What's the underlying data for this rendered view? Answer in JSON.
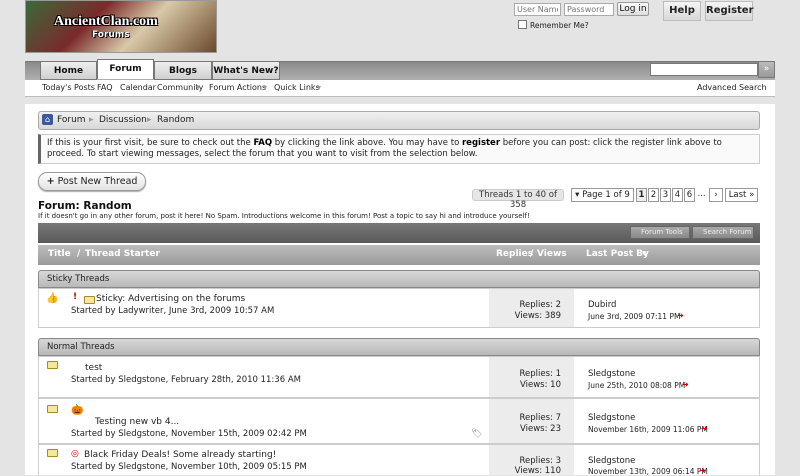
{
  "header": {
    "logo_text": "AncientClan.com",
    "logo_sub": "Forums",
    "username_placeholder": "User Name",
    "password_placeholder": "Password",
    "login_label": "Log in",
    "remember_label": "Remember Me?",
    "help_label": "Help",
    "register_label": "Register"
  },
  "nav": {
    "tabs": [
      "Home",
      "Forum",
      "Blogs",
      "What's New?"
    ],
    "sub": [
      "Today's Posts",
      "FAQ",
      "Calendar",
      "Community",
      "Forum Actions",
      "Quick Links"
    ],
    "advanced_search": "Advanced Search",
    "search_go": "»"
  },
  "breadcrumb": [
    "Forum",
    "Discussion",
    "Random"
  ],
  "notice": {
    "p1": "If this is your first visit, be sure to check out the",
    "faq": "FAQ",
    "p2": "by clicking the link above. You may have to",
    "register": "register",
    "p3": "before you can post: click the register link above to proceed. To start viewing messages, select the forum that you want to visit from the selection below."
  },
  "actions": {
    "new_thread": "Post New Thread",
    "threads_count": "Threads 1 to 40 of 358",
    "page_of": "Page 1 of 9",
    "pages": [
      "1",
      "2",
      "3",
      "4",
      "6"
    ],
    "ellipsis": "...",
    "next": "›",
    "last": "Last »"
  },
  "forum": {
    "title": "Forum: Random",
    "desc": "If it doesn't go in any other forum, post it here! No Spam. Introductions welcome in this forum! Post a topic to say hi and introduce yourself!",
    "tools": "Forum Tools",
    "search": "Search Forum"
  },
  "columns": {
    "title": "Title",
    "starter": "Thread Starter",
    "replies": "Replies",
    "views": "Views",
    "lastpost": "Last Post By"
  },
  "sections": {
    "sticky": "Sticky Threads",
    "normal": "Normal Threads"
  },
  "threads": [
    {
      "title": "Sticky: Advertising on the forums",
      "starter": "Started by Ladywriter, June 3rd, 2009 10:57 AM",
      "replies": "Replies: 2",
      "views": "Views: 389",
      "lp_user": "Dubird",
      "lp_date": "June 3rd, 2009 07:11 PM"
    },
    {
      "title": "test",
      "starter": "Started by Sledgstone, February 28th, 2010 11:36 AM",
      "replies": "Replies: 1",
      "views": "Views: 10",
      "lp_user": "Sledgstone",
      "lp_date": "June 25th, 2010 08:08 PM"
    },
    {
      "title": "Testing new vb 4...",
      "starter": "Started by Sledgstone, November 15th, 2009 02:42 PM",
      "replies": "Replies: 7",
      "views": "Views: 23",
      "lp_user": "Sledgstone",
      "lp_date": "November 16th, 2009 11:06 PM"
    },
    {
      "title": "Black Friday Deals! Some already starting!",
      "starter": "Started by Sledgstone, November 10th, 2009 05:15 PM",
      "replies": "Replies: 3",
      "views": "Views: 110",
      "lp_user": "Sledgstone",
      "lp_date": "November 13th, 2009 06:14 PM"
    }
  ]
}
